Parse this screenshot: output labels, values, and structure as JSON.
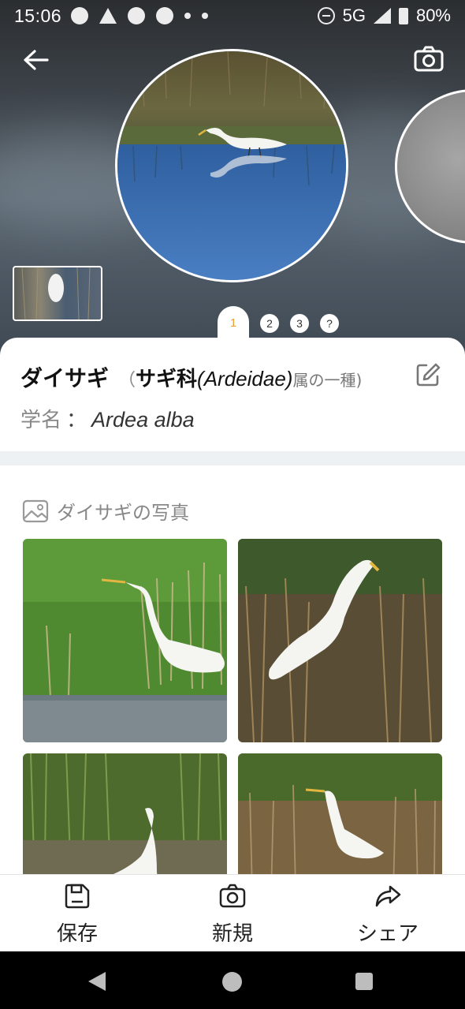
{
  "status_bar": {
    "time": "15:06",
    "network": "5G",
    "battery": "80%"
  },
  "top": {
    "back_icon": "arrow-left-icon",
    "camera_icon": "camera-icon",
    "pages": [
      "1",
      "2",
      "3",
      "?"
    ],
    "active_page": "1"
  },
  "species": {
    "japanese_name": "ダイサギ",
    "paren_open": "（",
    "family_jp": "サギ科",
    "family_latin": "(Ardeidae)",
    "genus_note": "属の一種)",
    "sci_label": "学名",
    "sci_colon": "：",
    "sci_name": "Ardea alba",
    "edit_icon": "edit-icon"
  },
  "photos": {
    "icon": "image-icon",
    "title": "ダイサギの写真"
  },
  "bottom_bar": {
    "save_label": "保存",
    "new_label": "新規",
    "share_label": "シェア"
  },
  "colors": {
    "accent": "#e8a030",
    "card_bg": "#ffffff",
    "muted_text": "#888888"
  }
}
